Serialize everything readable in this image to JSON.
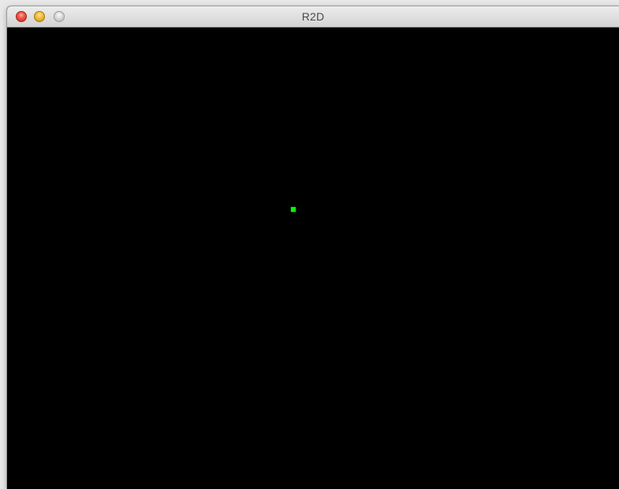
{
  "window": {
    "title": "R2D"
  },
  "controls": {
    "close": "close-icon",
    "minimize": "minimize-icon",
    "zoom": "zoom-icon"
  },
  "canvas": {
    "background": "#000000",
    "point_color": "#00ff00"
  }
}
